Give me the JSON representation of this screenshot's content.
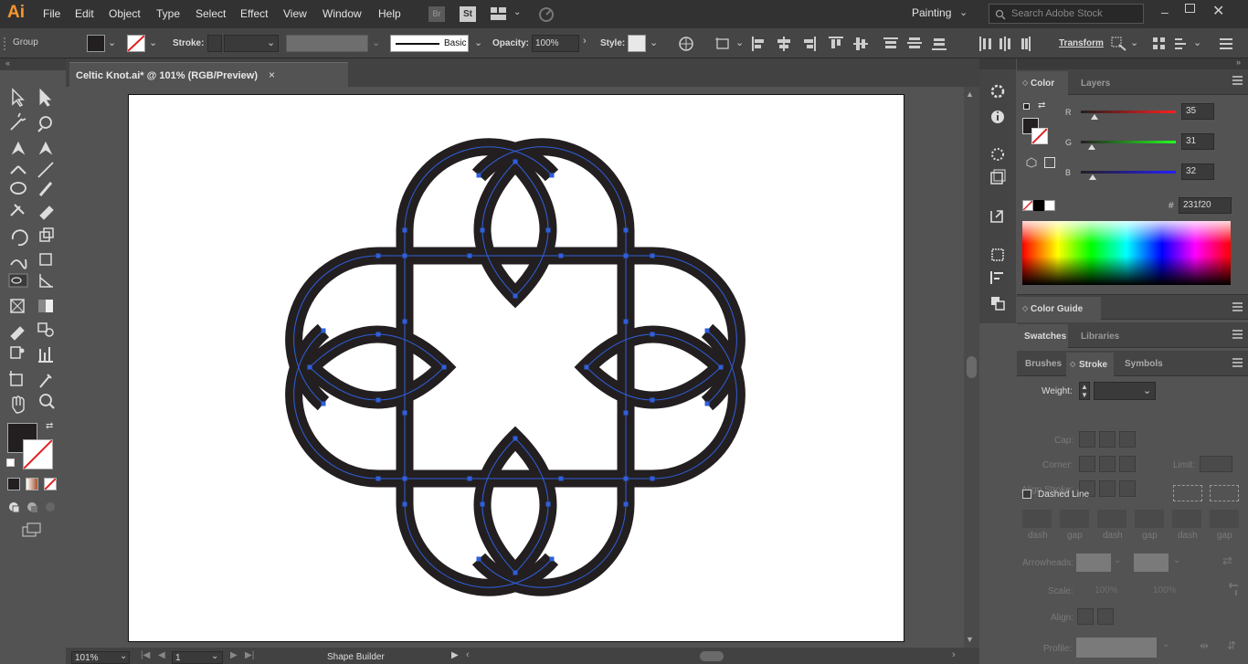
{
  "menubar": {
    "logo": "Ai",
    "items": [
      "File",
      "Edit",
      "Object",
      "Type",
      "Select",
      "Effect",
      "View",
      "Window",
      "Help"
    ],
    "bridge_label": "Br",
    "stock_label": "St",
    "workspace": "Painting",
    "search_placeholder": "Search Adobe Stock"
  },
  "control": {
    "selection": "Group",
    "stroke_label": "Stroke:",
    "brush_label": "Basic",
    "opacity_label": "Opacity:",
    "opacity_value": "100%",
    "style_label": "Style:",
    "transform_label": "Transform"
  },
  "document": {
    "tab_title": "Celtic Knot.ai* @ 101% (RGB/Preview)",
    "close": "×"
  },
  "status": {
    "zoom": "101%",
    "artboard": "1",
    "tool": "Shape Builder"
  },
  "colors": {
    "fill": "#231f20",
    "path": "#2f5fdc",
    "accent": "#f7962a"
  },
  "color_panel": {
    "tabs": [
      "Color",
      "Layers"
    ],
    "r_label": "R",
    "r_value": "35",
    "g_label": "G",
    "g_value": "31",
    "b_label": "B",
    "b_value": "32",
    "hex_symbol": "#",
    "hex_value": "231f20"
  },
  "color_guide": {
    "title": "Color Guide"
  },
  "swatch_tabs": [
    "Swatches",
    "Libraries"
  ],
  "stroke_tabs": [
    "Brushes",
    "Stroke",
    "Symbols"
  ],
  "stroke_panel": {
    "weight_label": "Weight:",
    "cap_label": "Cap:",
    "corner_label": "Corner:",
    "limit_label": "Limit:",
    "align_label": "Align Stroke:",
    "dashed_label": "Dashed Line",
    "dash_labels": [
      "dash",
      "gap",
      "dash",
      "gap",
      "dash",
      "gap"
    ],
    "arrowheads_label": "Arrowheads:",
    "scale_label": "Scale:",
    "scale_value_1": "100%",
    "scale_value_2": "100%",
    "align_arrow_label": "Align:",
    "profile_label": "Profile:"
  }
}
